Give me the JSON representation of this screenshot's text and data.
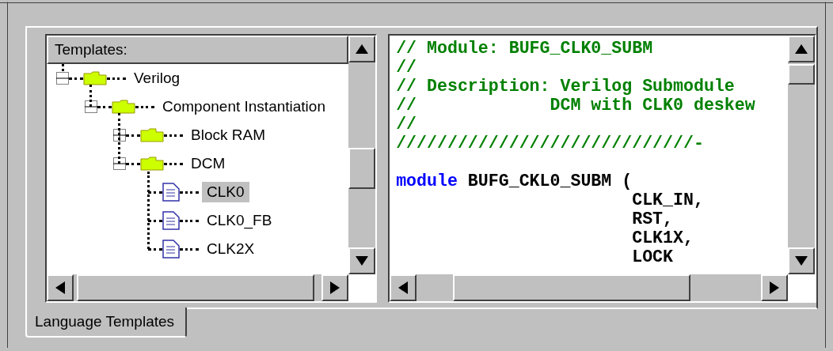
{
  "tree": {
    "header": "Templates:",
    "nodes": [
      {
        "label": "Verilog",
        "kind": "folder",
        "expanded": true,
        "selected": false,
        "children": [
          {
            "label": "Component Instantiation",
            "kind": "folder",
            "expanded": true,
            "selected": false,
            "children": [
              {
                "label": "Block RAM",
                "kind": "folder",
                "expanded": false,
                "selected": false
              },
              {
                "label": "DCM",
                "kind": "folder",
                "expanded": true,
                "selected": false,
                "children": [
                  {
                    "label": "CLK0",
                    "kind": "file",
                    "selected": true
                  },
                  {
                    "label": "CLK0_FB",
                    "kind": "file",
                    "selected": false
                  },
                  {
                    "label": "CLK2X",
                    "kind": "file",
                    "selected": false
                  }
                ]
              }
            ]
          }
        ]
      }
    ]
  },
  "code": {
    "lines": [
      {
        "kind": "comment",
        "text": "// Module: BUFG_CLK0_SUBM"
      },
      {
        "kind": "comment",
        "text": "//"
      },
      {
        "kind": "comment",
        "text": "// Description: Verilog Submodule"
      },
      {
        "kind": "comment",
        "text": "//             DCM with CLK0 deskew"
      },
      {
        "kind": "comment",
        "text": "//"
      },
      {
        "kind": "comment",
        "text": "/////////////////////////////-"
      },
      {
        "kind": "blank"
      },
      {
        "kind": "code",
        "parts": [
          {
            "kind": "keyword",
            "text": "module"
          },
          {
            "kind": "plain",
            "text": " BUFG_CKL0_SUBM ("
          }
        ]
      },
      {
        "kind": "code",
        "parts": [
          {
            "kind": "plain",
            "text": "                       CLK_IN,"
          }
        ]
      },
      {
        "kind": "code",
        "parts": [
          {
            "kind": "plain",
            "text": "                       RST,"
          }
        ]
      },
      {
        "kind": "code",
        "parts": [
          {
            "kind": "plain",
            "text": "                       CLK1X,"
          }
        ]
      },
      {
        "kind": "code",
        "parts": [
          {
            "kind": "plain",
            "text": "                       LOCK"
          }
        ]
      }
    ]
  },
  "tabs": [
    {
      "label": "Language Templates",
      "selected": true
    }
  ]
}
